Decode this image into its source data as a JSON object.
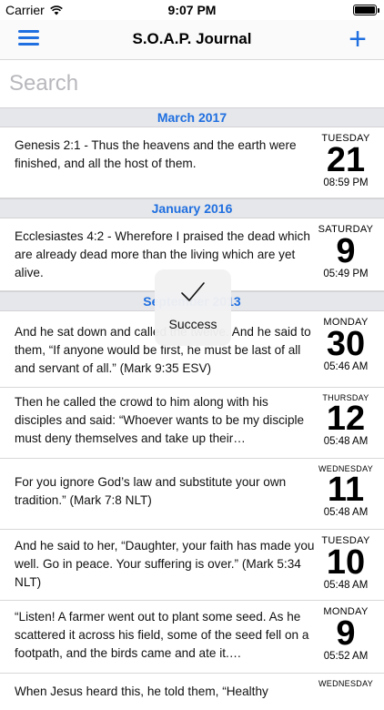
{
  "status": {
    "carrier": "Carrier",
    "time": "9:07 PM"
  },
  "nav": {
    "title": "S.O.A.P. Journal",
    "menu_icon": "hamburger-menu-icon",
    "add_icon": "plus-icon"
  },
  "search": {
    "placeholder": "Search"
  },
  "hud": {
    "label": "Success",
    "icon": "checkmark-icon"
  },
  "sections": [
    {
      "title": "March 2017",
      "entries": [
        {
          "text": "Genesis 2:1 - Thus the heavens and the earth were finished, and all the host of them.",
          "dow": "TUESDAY",
          "day": "21",
          "time": "08:59 PM"
        }
      ]
    },
    {
      "title": "January 2016",
      "entries": [
        {
          "text": "Ecclesiastes 4:2 - Wherefore I praised the dead which are already dead more than the living which are yet alive.",
          "dow": "SATURDAY",
          "day": "9",
          "time": "05:49 PM"
        }
      ]
    },
    {
      "title": "September 2013",
      "entries": [
        {
          "text": "And he sat down and called the twelve. And he said to them, “If anyone would be first, he must be last of all and servant of all.” (Mark 9:35 ESV)",
          "dow": "MONDAY",
          "day": "30",
          "time": "05:46 AM"
        },
        {
          "text": "Then he called the crowd to him along with his disciples and said: “Whoever wants to be my disciple must deny themselves and take up their…",
          "dow": "THURSDAY",
          "day": "12",
          "time": "05:48 AM"
        },
        {
          "text": "For you ignore God’s law and substitute your own tradition.” (Mark 7:8 NLT)",
          "dow": "WEDNESDAY",
          "day": "11",
          "time": "05:48 AM"
        },
        {
          "text": "And he said to her, “Daughter, your faith has made you well. Go in peace. Your suffering is over.” (Mark 5:34 NLT)",
          "dow": "TUESDAY",
          "day": "10",
          "time": "05:48 AM"
        },
        {
          "text": "“Listen! A farmer went out to plant some seed. As he scattered it across his field, some of the seed fell on a footpath, and the birds came and ate it.…",
          "dow": "MONDAY",
          "day": "9",
          "time": "05:52 AM"
        },
        {
          "text": "When Jesus heard this, he told them, “Healthy",
          "dow": "WEDNESDAY",
          "day": "",
          "time": ""
        }
      ]
    }
  ]
}
